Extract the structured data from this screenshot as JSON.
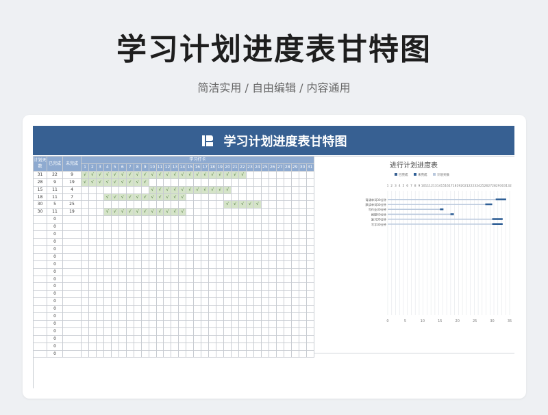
{
  "page": {
    "title": "学习计划进度表甘特图",
    "subtitle": "简洁实用 / 自由编辑 / 内容通用"
  },
  "sheet": {
    "banner_title": "学习计划进度表甘特图",
    "headers": {
      "plan_days": "计划天数",
      "done": "已完成",
      "undone": "未完成",
      "days_group": "学习打卡"
    },
    "days": [
      "1",
      "2",
      "3",
      "4",
      "5",
      "6",
      "7",
      "8",
      "9",
      "10",
      "11",
      "12",
      "13",
      "14",
      "15",
      "16",
      "17",
      "18",
      "19",
      "20",
      "21",
      "22",
      "23",
      "24",
      "25",
      "26",
      "27",
      "28",
      "29",
      "30",
      "31"
    ],
    "check_mark": "√",
    "rows": [
      {
        "plan": "31",
        "done": "22",
        "undone": "9",
        "check_start": 1,
        "check_count": 22
      },
      {
        "plan": "28",
        "done": "9",
        "undone": "19",
        "check_start": 1,
        "check_count": 9
      },
      {
        "plan": "15",
        "done": "11",
        "undone": "4",
        "check_start": 10,
        "check_count": 11
      },
      {
        "plan": "18",
        "done": "11",
        "undone": "7",
        "check_start": 4,
        "check_count": 11
      },
      {
        "plan": "30",
        "done": "5",
        "undone": "25",
        "check_start": 20,
        "check_count": 5
      },
      {
        "plan": "30",
        "done": "11",
        "undone": "19",
        "check_start": 4,
        "check_count": 11
      }
    ],
    "empty_rows_done_value": "0",
    "empty_row_count": 19
  },
  "chart_data": {
    "type": "bar",
    "title": "进行计划进度表",
    "legend": [
      "已完成",
      "未完成",
      "计划天数"
    ],
    "legend_position": "top",
    "top_ticks": [
      "1",
      "2",
      "3",
      "4",
      "5",
      "6",
      "7",
      "8",
      "9",
      "10",
      "11",
      "12",
      "13",
      "14",
      "15",
      "16",
      "17",
      "18",
      "19",
      "20",
      "21",
      "22",
      "23",
      "24",
      "25",
      "26",
      "27",
      "28",
      "29",
      "30",
      "31",
      "32"
    ],
    "xaxis_ticks": [
      "0",
      "5",
      "10",
      "15",
      "20",
      "25",
      "30",
      "35"
    ],
    "xlim": [
      0,
      35
    ],
    "categories": [
      "背诵单词30分钟",
      "默读单词30分钟",
      "写作业30分钟",
      "刷题40分钟",
      "复习30分钟",
      "写字30分钟"
    ],
    "series": [
      {
        "name": "已完成",
        "values": [
          31,
          28,
          15,
          18,
          30,
          30
        ]
      },
      {
        "name": "未完成",
        "values": [
          34,
          30,
          16,
          19,
          33,
          33
        ]
      },
      {
        "name": "计划天数",
        "values": [
          31,
          28,
          15,
          18,
          30,
          30
        ]
      }
    ],
    "colors": {
      "done": "#376092",
      "undone": "#2f5f96",
      "plan": "#b8c7dc",
      "grid": "#e3e6ea"
    }
  }
}
